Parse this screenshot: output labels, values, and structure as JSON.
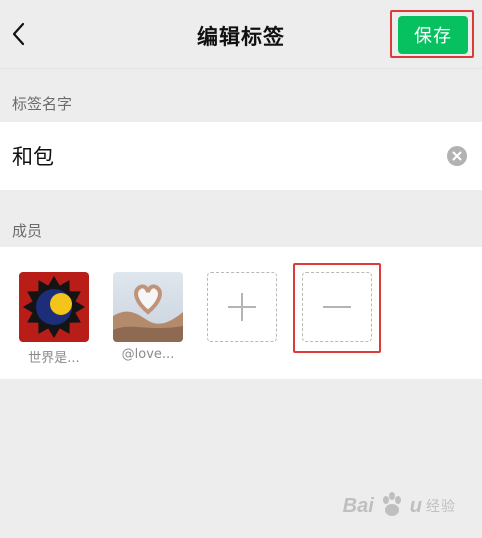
{
  "header": {
    "title": "编辑标签",
    "save_label": "保存",
    "back_icon": "chevron-left-icon"
  },
  "name_section": {
    "label": "标签名字",
    "value": "和包",
    "clear_icon": "clear-circle-icon"
  },
  "members_section": {
    "label": "成员",
    "members": [
      {
        "name": "世界是...",
        "avatar": "sun-avatar"
      },
      {
        "name": "@love...",
        "avatar": "heart-hands-photo-avatar"
      }
    ],
    "add_icon": "plus-icon",
    "remove_icon": "minus-icon"
  },
  "watermark": {
    "brand": "Bai",
    "brand_tail": "u",
    "sub": "经验"
  },
  "colors": {
    "accent": "#07c160",
    "highlight": "#dd3a3a",
    "page_bg": "#ededed",
    "card_bg": "#ffffff"
  }
}
